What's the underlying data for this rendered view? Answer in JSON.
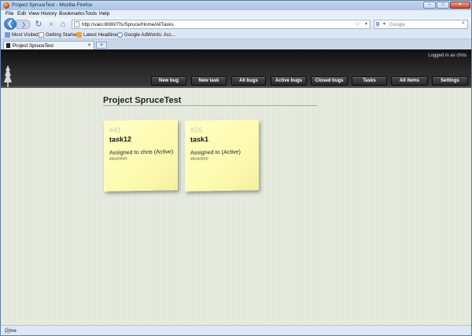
{
  "window": {
    "title": "Project SpruceTest - Mozilla Firefox",
    "buttons": {
      "minimize": "–",
      "maximize": "□",
      "close": "✕"
    }
  },
  "menu": [
    "File",
    "Edit",
    "View",
    "History",
    "Bookmarks",
    "Tools",
    "Help"
  ],
  "nav": {
    "back_glyph": "❮",
    "forward_glyph": "❯",
    "reload_glyph": "↻",
    "stop_glyph": "✕",
    "home_glyph": "⌂",
    "url": "http://vaio:8080/Tfs/Spruce/Home/AllTasks",
    "search_placeholder": "Google",
    "search_engine_letter": "g",
    "star_glyph": "☆",
    "dropdown_glyph": "▾",
    "search_glyph": "⌕"
  },
  "bookmarks": [
    {
      "label": "Most Visited",
      "icon": "most-visited-icon"
    },
    {
      "label": "Getting Started",
      "icon": "page-icon"
    },
    {
      "label": "Latest Headlines",
      "icon": "rss-icon"
    },
    {
      "label": "Google AdWords: Acc...",
      "icon": "google-icon"
    }
  ],
  "tabs": {
    "active_label": "Project SpruceTest",
    "close_glyph": "✕",
    "new_tab_glyph": "+"
  },
  "site": {
    "login_text": "Logged in as chris",
    "menu": [
      "New bug",
      "New task",
      "All bugs",
      "Active bugs",
      "Closed bugs",
      "Tasks",
      "All items",
      "Settings"
    ]
  },
  "page": {
    "title": "Project SpruceTest",
    "cards": [
      {
        "number": "#41",
        "title": "task12",
        "assigned": "Assigned to chris (Active)",
        "date": "28/10/2010"
      },
      {
        "number": "#26",
        "title": "task1",
        "assigned": "Assigned to (Active)",
        "date": "26/10/2010"
      }
    ]
  },
  "status": {
    "text": "Done"
  },
  "colors": {
    "accent": "#3d73b8",
    "note": "#fdfbb0",
    "header": "#1e1e1e",
    "background": "#e8ece0"
  }
}
